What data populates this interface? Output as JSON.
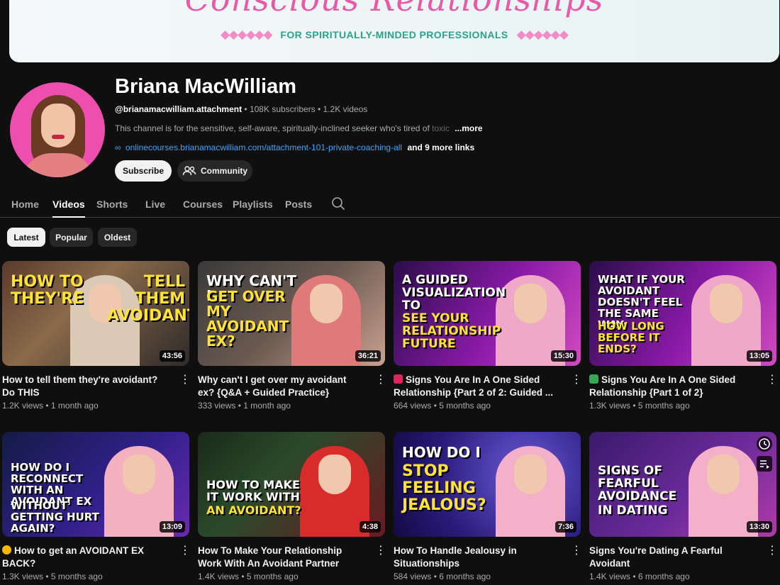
{
  "banner": {
    "script_title": "Conscious Relationships",
    "tagline": "FOR SPIRITUALLY-MINDED PROFESSIONALS",
    "diamonds_left": "◆◆◆◆◆◆",
    "diamonds_right": "◆◆◆◆◆◆"
  },
  "channel": {
    "name": "Briana MacWilliam",
    "handle": "@brianamacwilliam.attachment",
    "subscribers": " • 108K subscribers • 1.2K videos",
    "description": "This channel is for the sensitive, self-aware, spiritually-inclined seeker who's tired of ",
    "description_fade": "toxic",
    "more_label": "...more",
    "link_url": "onlinecourses.brianamacwilliam.com/attachment-101-private-coaching-all",
    "more_links": "and 9 more links",
    "subscribe_label": "Subscribe",
    "community_label": "Community"
  },
  "tabs": [
    {
      "label": "Home"
    },
    {
      "label": "Videos",
      "active": true
    },
    {
      "label": "Shorts"
    },
    {
      "label": "Live"
    },
    {
      "label": "Courses"
    },
    {
      "label": "Playlists"
    },
    {
      "label": "Posts"
    }
  ],
  "chips": [
    {
      "label": "Latest",
      "active": true
    },
    {
      "label": "Popular"
    },
    {
      "label": "Oldest"
    }
  ],
  "videos": [
    {
      "title": "How to tell them they're avoidant? Do THIS",
      "views": "1.2K views",
      "age": "1 month ago",
      "duration": "43:56",
      "thumb_text_a": "How to they're",
      "thumb_text_b": "tell them avoidant?"
    },
    {
      "title": "Why can't I get over my avoidant ex? {Q&A + Guided Practice}",
      "views": "333 views",
      "age": "1 month ago",
      "duration": "36:21",
      "thumb_text_a": "Why can't I",
      "thumb_text_b": "get over my avoidant ex?"
    },
    {
      "title": "Signs You Are In A One Sided Relationship {Part 2 of 2: Guided ...",
      "views": "664 views",
      "age": "5 months ago",
      "duration": "15:30",
      "thumb_text_a": "A guided visualization to",
      "thumb_text_b": "see your relationship future",
      "emoji": "broken-heart"
    },
    {
      "title": "Signs You Are In A One Sided Relationship {Part 1 of 2}",
      "views": "1.3K views",
      "age": "5 months ago",
      "duration": "13:05",
      "thumb_text_a": "What if your avoidant doesn't feel the same way:",
      "thumb_text_b": "how long before it ends?",
      "emoji": "check-mark"
    },
    {
      "title": "How to get an AVOIDANT EX BACK?",
      "views": "1.3K views",
      "age": "5 months ago",
      "duration": "13:09",
      "thumb_text_a": "How do I reconnect with an avoidant ex",
      "thumb_text_b": "without getting hurt again?",
      "emoji": "thinking-face"
    },
    {
      "title": "How To Make Your Relationship Work With An Avoidant Partner",
      "views": "1.4K views",
      "age": "5 months ago",
      "duration": "4:38",
      "thumb_text_a": "How to make it work with",
      "thumb_text_b": "an avoidant?"
    },
    {
      "title": "How To Handle Jealousy in Situationships",
      "views": "584 views",
      "age": "6 months ago",
      "duration": "7:36",
      "thumb_text_a": "How do I",
      "thumb_text_b": "stop feeling jealous?"
    },
    {
      "title": "Signs You're Dating A Fearful Avoidant",
      "views": "1.4K views",
      "age": "6 months ago",
      "duration": "13:30",
      "thumb_text_a": "Signs of fearful avoidance",
      "thumb_text_b": "in dating"
    }
  ],
  "colors": {
    "background": "#0f0f0f",
    "link": "#3ea6ff",
    "banner_pink": "#e85aa8",
    "banner_teal": "#2aa38c"
  }
}
